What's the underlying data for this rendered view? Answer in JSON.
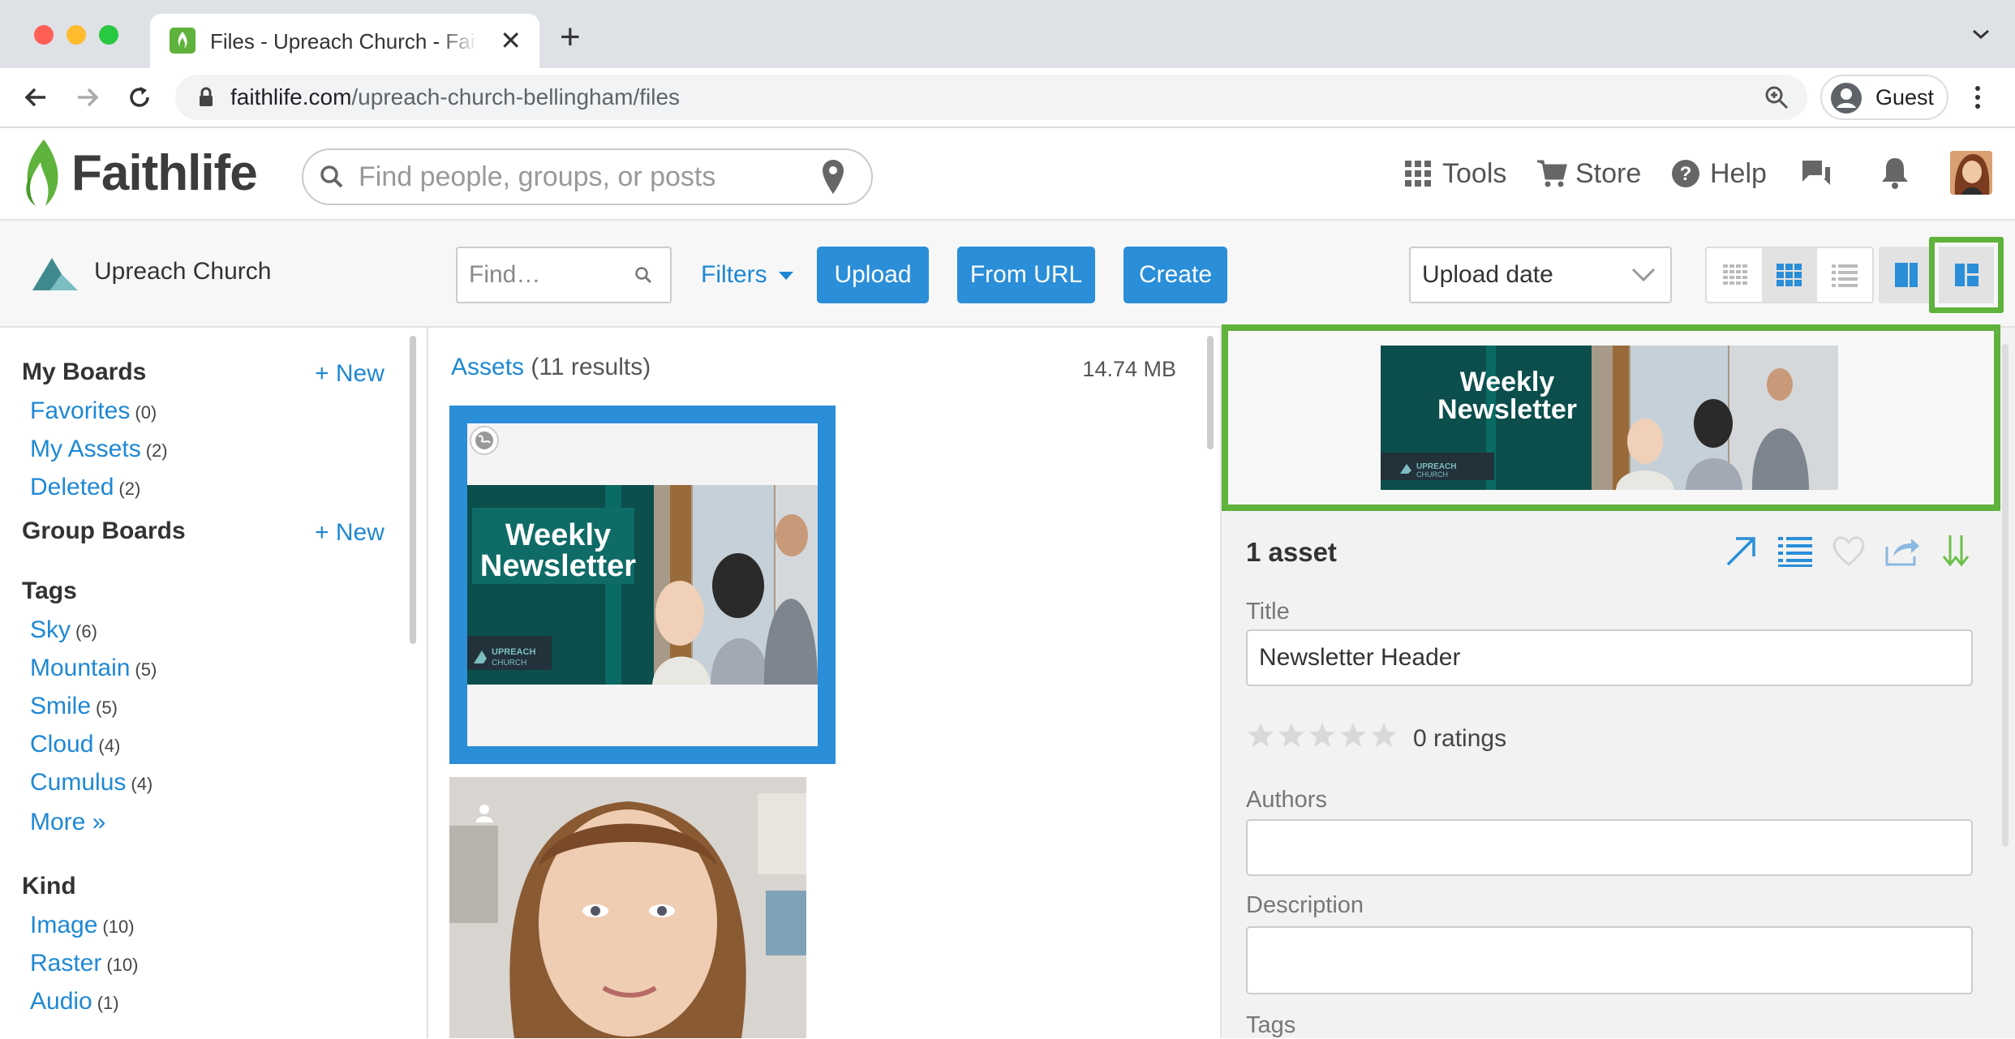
{
  "browser": {
    "tab_title": "Files - Upreach Church - Faithlife",
    "url_host": "faithlife.com",
    "url_path": "/upreach-church-bellingham/files",
    "profile_label": "Guest"
  },
  "header": {
    "logo_text": "Faithlife",
    "search_placeholder": "Find people, groups, or posts",
    "nav": {
      "tools": "Tools",
      "store": "Store",
      "help": "Help"
    }
  },
  "group_bar": {
    "group_name": "Upreach Church",
    "find_placeholder": "Find…",
    "filters_label": "Filters",
    "upload_label": "Upload",
    "from_url_label": "From URL",
    "create_label": "Create",
    "sort_value": "Upload date"
  },
  "sidebar": {
    "my_boards": {
      "title": "My Boards",
      "new_label": "+ New",
      "items": [
        {
          "label": "Favorites",
          "count": "(0)"
        },
        {
          "label": "My Assets",
          "count": "(2)"
        },
        {
          "label": "Deleted",
          "count": "(2)"
        }
      ]
    },
    "group_boards": {
      "title": "Group Boards",
      "new_label": "+ New"
    },
    "tags": {
      "title": "Tags",
      "items": [
        {
          "label": "Sky",
          "count": "(6)"
        },
        {
          "label": "Mountain",
          "count": "(5)"
        },
        {
          "label": "Smile",
          "count": "(5)"
        },
        {
          "label": "Cloud",
          "count": "(4)"
        },
        {
          "label": "Cumulus",
          "count": "(4)"
        }
      ],
      "more_label": "More »"
    },
    "kind": {
      "title": "Kind",
      "items": [
        {
          "label": "Image",
          "count": "(10)"
        },
        {
          "label": "Raster",
          "count": "(10)"
        },
        {
          "label": "Audio",
          "count": "(1)"
        }
      ]
    }
  },
  "assets": {
    "link_label": "Assets",
    "results": "(11 results)",
    "total_size": "14.74 MB",
    "thumb_heading_line1": "Weekly",
    "thumb_heading_line2": "Newsletter",
    "thumb_brand_line1": "UPREACH",
    "thumb_brand_line2": "CHURCH"
  },
  "detail": {
    "count_label": "1 asset",
    "title_label": "Title",
    "title_value": "Newsletter Header",
    "ratings_label": "0 ratings",
    "authors_label": "Authors",
    "authors_value": "",
    "description_label": "Description",
    "description_value": "",
    "tags_label": "Tags"
  },
  "colors": {
    "accent_blue": "#2a8ed8",
    "link_blue": "#1e88d4",
    "highlight_green": "#5fb23b",
    "newsletter_teal": "#0f5a57"
  }
}
